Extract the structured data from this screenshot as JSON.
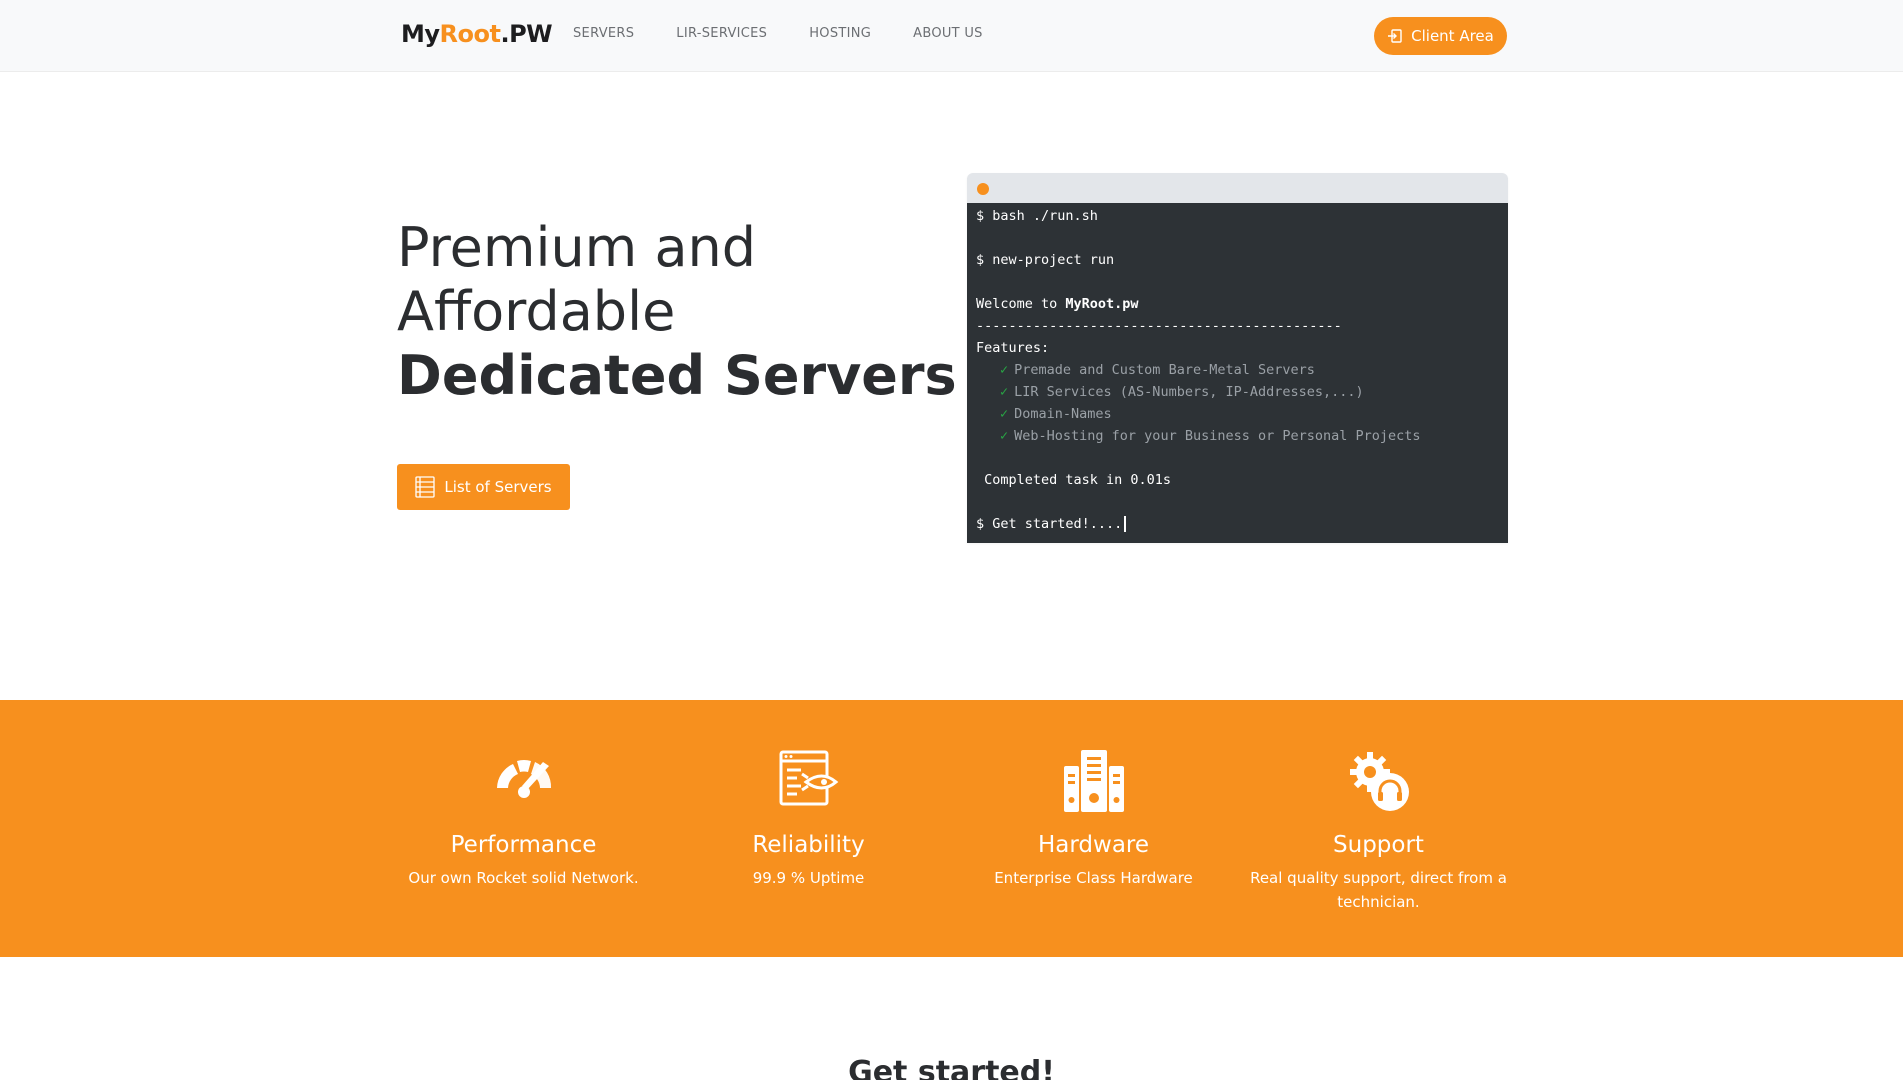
{
  "brand": {
    "part1": "My",
    "part2": "Root",
    "part3": ".PW"
  },
  "nav": {
    "links": [
      "SERVERS",
      "LIR-SERVICES",
      "HOSTING",
      "ABOUT US"
    ],
    "client_area": "Client Area"
  },
  "hero": {
    "line1": "Premium and",
    "line2": "Affordable",
    "line3": "Dedicated Servers",
    "button": "List of Servers"
  },
  "terminal": {
    "lines": [
      "$ bash ./run.sh",
      "",
      "$ new-project run",
      "",
      "Welcome to ",
      "---------------------------------------------",
      "Features:"
    ],
    "welcome_name": "MyRoot.pw",
    "features": [
      "Premade and Custom Bare-Metal Servers",
      "LIR Services (AS-Numbers, IP-Addresses,...)",
      "Domain-Names",
      "Web-Hosting for your Business or Personal Projects"
    ],
    "check": "✓",
    "completed": " Completed task in 0.01s",
    "prompt": "$ Get started!...."
  },
  "features": [
    {
      "title": "Performance",
      "desc": "Our own Rocket solid Network.",
      "icon": "speedometer-icon"
    },
    {
      "title": "Reliability",
      "desc": "99.9 % Uptime",
      "icon": "rocket-window-icon"
    },
    {
      "title": "Hardware",
      "desc": "Enterprise Class Hardware",
      "icon": "server-rack-icon"
    },
    {
      "title": "Support",
      "desc": "Real quality support, direct from a technician.",
      "icon": "gear-headset-icon"
    }
  ],
  "get_started": "Get started!",
  "colors": {
    "accent": "#f7901e",
    "terminal_bg": "#2d3236",
    "navbar_bg": "#f8f9fa"
  }
}
